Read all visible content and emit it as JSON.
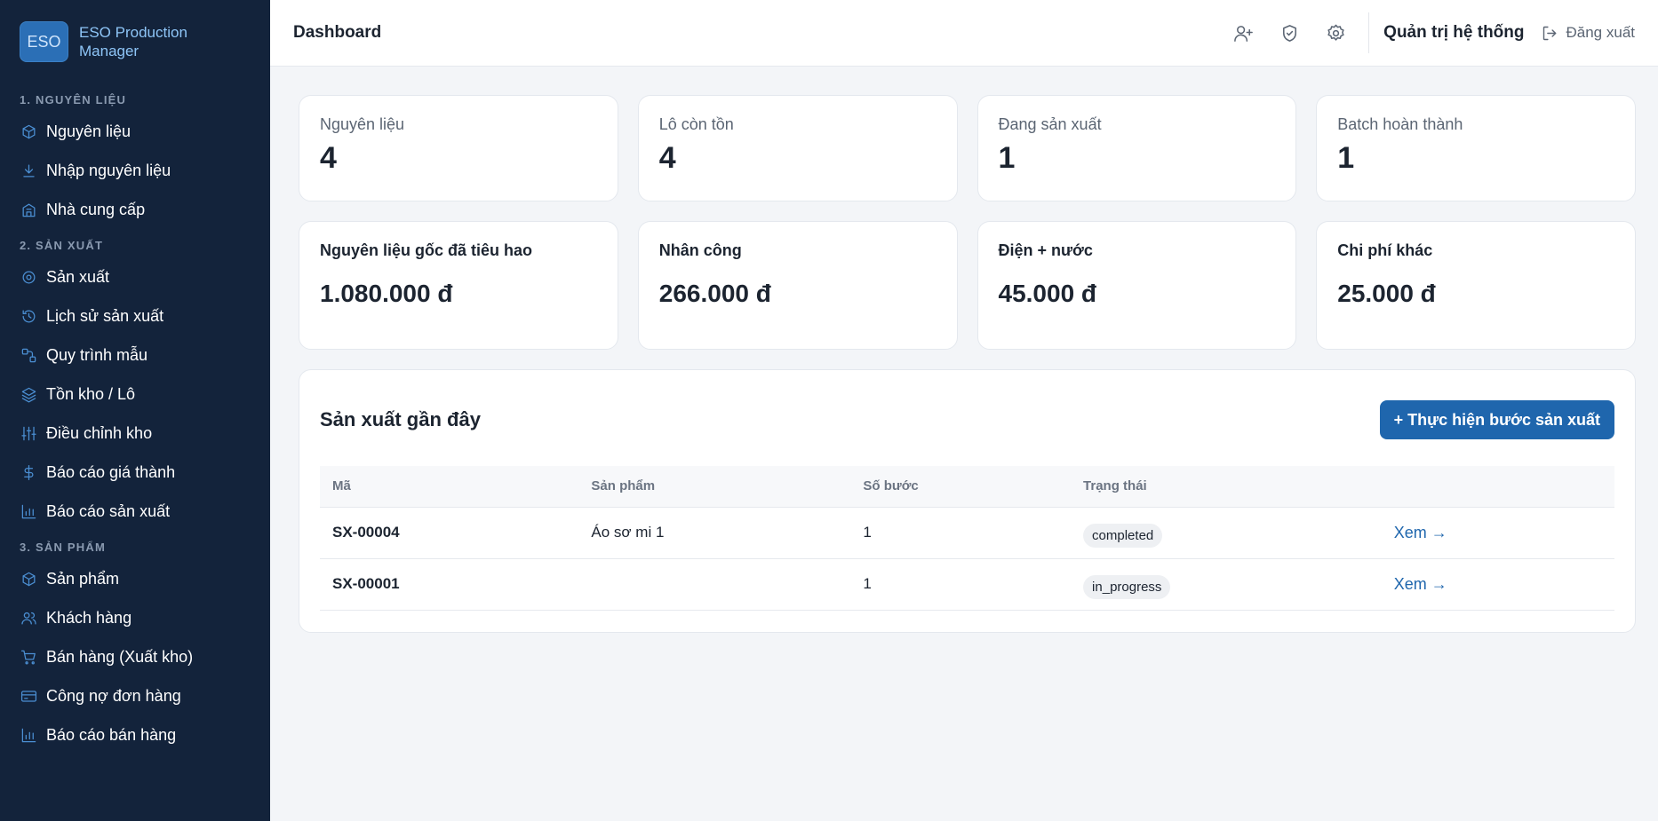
{
  "brand": {
    "logo": "ESO",
    "name": "ESO Production Manager"
  },
  "sidebar": {
    "sections": [
      {
        "label": "1. NGUYÊN LIỆU",
        "items": [
          {
            "label": "Nguyên liệu",
            "icon": "box-icon"
          },
          {
            "label": "Nhập nguyên liệu",
            "icon": "download-icon"
          },
          {
            "label": "Nhà cung cấp",
            "icon": "building-icon"
          }
        ]
      },
      {
        "label": "2. SẢN XUẤT",
        "items": [
          {
            "label": "Sản xuất",
            "icon": "gear-icon"
          },
          {
            "label": "Lịch sử sản xuất",
            "icon": "history-icon"
          },
          {
            "label": "Quy trình mẫu",
            "icon": "workflow-icon"
          },
          {
            "label": "Tồn kho / Lô",
            "icon": "layers-icon"
          },
          {
            "label": "Điều chỉnh kho",
            "icon": "sliders-icon"
          },
          {
            "label": "Báo cáo giá thành",
            "icon": "dollar-icon"
          },
          {
            "label": "Báo cáo sản xuất",
            "icon": "bar-chart-icon"
          }
        ]
      },
      {
        "label": "3. SẢN PHẨM",
        "items": [
          {
            "label": "Sản phẩm",
            "icon": "box-icon"
          },
          {
            "label": "Khách hàng",
            "icon": "users-icon"
          },
          {
            "label": "Bán hàng (Xuất kho)",
            "icon": "cart-icon"
          },
          {
            "label": "Công nợ đơn hàng",
            "icon": "credit-card-icon"
          },
          {
            "label": "Báo cáo bán hàng",
            "icon": "bar-chart-icon"
          }
        ]
      }
    ]
  },
  "header": {
    "title": "Dashboard",
    "icons": [
      "add-user-icon",
      "shield-icon",
      "gear-icon"
    ],
    "admin_label": "Quản trị hệ thống",
    "logout_label": "Đăng xuất"
  },
  "stats": [
    {
      "label": "Nguyên liệu",
      "value": "4"
    },
    {
      "label": "Lô còn tồn",
      "value": "4"
    },
    {
      "label": "Đang sản xuất",
      "value": "1"
    },
    {
      "label": "Batch hoàn thành",
      "value": "1"
    }
  ],
  "costs": [
    {
      "label": "Nguyên liệu gốc đã tiêu hao",
      "value": "1.080.000 đ"
    },
    {
      "label": "Nhân công",
      "value": "266.000 đ"
    },
    {
      "label": "Điện + nước",
      "value": "45.000 đ"
    },
    {
      "label": "Chi phí khác",
      "value": "25.000 đ"
    }
  ],
  "recent": {
    "title": "Sản xuất gần đây",
    "action_label": "+ Thực hiện bước sản xuất",
    "columns": [
      "Mã",
      "Sản phẩm",
      "Số bước",
      "Trạng thái",
      ""
    ],
    "rows": [
      {
        "code": "SX-00004",
        "product": "Áo sơ mi 1",
        "steps": "1",
        "status": "completed",
        "link": "Xem →"
      },
      {
        "code": "SX-00001",
        "product": "",
        "steps": "1",
        "status": "in_progress",
        "link": "Xem →"
      }
    ]
  },
  "colors": {
    "sidebar_bg": "#13233b",
    "accent": "#1f66ad",
    "icon_blue": "#4b8fd3"
  }
}
